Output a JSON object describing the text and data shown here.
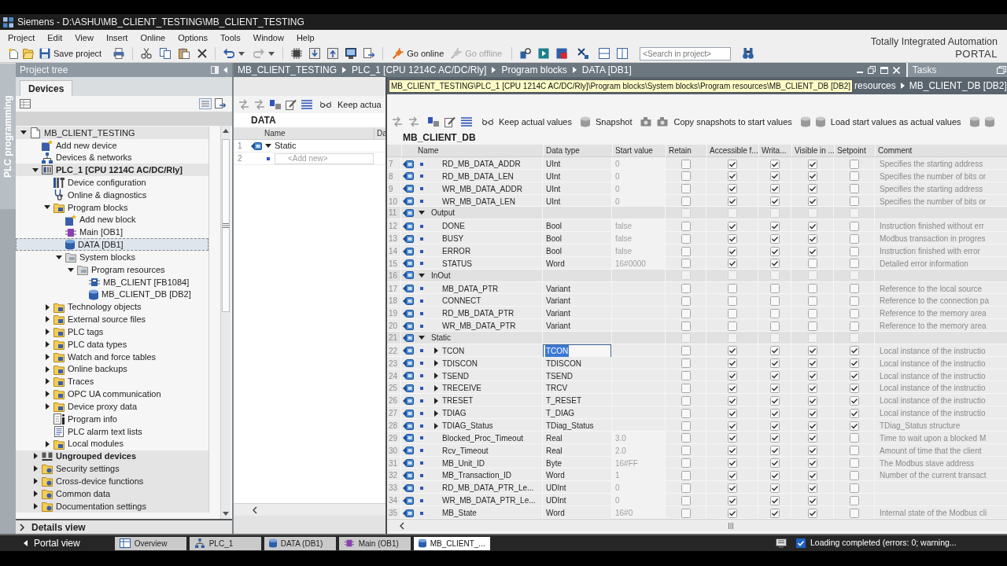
{
  "title_bar": {
    "title": "Siemens - D:\\ASHU\\MB_CLIENT_TESTING\\MB_CLIENT_TESTING"
  },
  "menu": [
    "Project",
    "Edit",
    "View",
    "Insert",
    "Online",
    "Options",
    "Tools",
    "Window",
    "Help"
  ],
  "toolbar": {
    "buttons": [
      {
        "kind": "save",
        "label": "Save project",
        "disabled": false
      },
      {
        "kind": "undo",
        "disabled": false
      },
      {
        "kind": "redo",
        "disabled": true
      },
      {
        "kind": "online",
        "label": "Go online",
        "disabled": false
      },
      {
        "kind": "offline",
        "label": "Go offline",
        "disabled": true
      }
    ],
    "search": {
      "placeholder": "<Search in project>"
    }
  },
  "branding": {
    "line_1": "Totally Integrated Automation",
    "line_2": "PORTAL"
  },
  "side_tab": {
    "label": "PLC programming"
  },
  "project_tree": {
    "title": "Project tree",
    "tabs": [
      {
        "label": "Devices",
        "selected": true
      }
    ],
    "items": [
      {
        "label": "MB_CLIENT_TESTING",
        "kind": "project",
        "expanded": true,
        "selected": false,
        "children": [
          {
            "label": "Add new device",
            "kind": "add",
            "selected": false
          },
          {
            "label": "Devices & networks",
            "kind": "network",
            "selected": false
          },
          {
            "label": "PLC_1 [CPU 1214C AC/DC/Rly]",
            "kind": "plc",
            "expanded": true,
            "selected": false,
            "children": [
              {
                "label": "Device configuration",
                "kind": "config",
                "selected": false
              },
              {
                "label": "Online & diagnostics",
                "kind": "diagnostics",
                "selected": false
              },
              {
                "label": "Program blocks",
                "kind": "folder",
                "expanded": true,
                "selected": false,
                "children": [
                  {
                    "label": "Add new block",
                    "kind": "add",
                    "selected": false
                  },
                  {
                    "label": "Main [OB1]",
                    "kind": "ob",
                    "selected": false
                  },
                  {
                    "label": "DATA [DB1]",
                    "kind": "db",
                    "selected": true
                  },
                  {
                    "label": "System blocks",
                    "kind": "system_folder",
                    "expanded": true,
                    "selected": false,
                    "children": [
                      {
                        "label": "Program resources",
                        "kind": "system_folder",
                        "expanded": true,
                        "selected": false,
                        "children": [
                          {
                            "label": "MB_CLIENT [FB1084]",
                            "kind": "fb",
                            "selected": false
                          },
                          {
                            "label": "MB_CLIENT_DB [DB2]",
                            "kind": "db",
                            "selected": false
                          }
                        ]
                      }
                    ]
                  }
                ]
              },
              {
                "label": "Technology objects",
                "kind": "folder",
                "expanded": false,
                "selected": false
              },
              {
                "label": "External source files",
                "kind": "folder",
                "expanded": false,
                "selected": false
              },
              {
                "label": "PLC tags",
                "kind": "folder",
                "expanded": false,
                "selected": false
              },
              {
                "label": "PLC data types",
                "kind": "folder",
                "expanded": false,
                "selected": false
              },
              {
                "label": "Watch and force tables",
                "kind": "folder",
                "expanded": false,
                "selected": false
              },
              {
                "label": "Online backups",
                "kind": "folder",
                "expanded": false,
                "selected": false
              },
              {
                "label": "Traces",
                "kind": "folder",
                "expanded": false,
                "selected": false
              },
              {
                "label": "OPC UA communication",
                "kind": "folder",
                "expanded": false,
                "selected": false
              },
              {
                "label": "Device proxy data",
                "kind": "folder",
                "expanded": false,
                "selected": false
              },
              {
                "label": "Program info",
                "kind": "info",
                "selected": false
              },
              {
                "label": "PLC alarm text lists",
                "kind": "text_list",
                "selected": false
              },
              {
                "label": "Local modules",
                "kind": "folder",
                "expanded": false,
                "selected": false
              }
            ]
          },
          {
            "label": "Ungrouped devices",
            "kind": "device_group",
            "expanded": false,
            "selected": false
          },
          {
            "label": "Security settings",
            "kind": "group",
            "expanded": false,
            "selected": false
          },
          {
            "label": "Cross-device functions",
            "kind": "group",
            "expanded": false,
            "selected": false
          },
          {
            "label": "Common data",
            "kind": "group",
            "expanded": false,
            "selected": false
          },
          {
            "label": "Documentation settings",
            "kind": "group",
            "expanded": false,
            "selected": false
          }
        ]
      }
    ]
  },
  "details_view": {
    "label": "Details view",
    "expanded": false
  },
  "breadcrumb": [
    "MB_CLIENT_TESTING",
    "PLC_1 [CPU 1214C AC/DC/Rly]",
    "Program blocks",
    "DATA [DB1]"
  ],
  "tasks": {
    "title": "Tasks"
  },
  "data_editor": {
    "toolbar_labels": [
      "Keep actua"
    ],
    "block_name": "DATA",
    "columns": [
      "Name",
      "Da"
    ],
    "rows": [
      {
        "num": "1",
        "kind": "section",
        "name": "Static",
        "expanded": true,
        "children": [
          {
            "num": "2",
            "kind": "add",
            "placeholder": "<Add new>"
          }
        ]
      }
    ]
  },
  "db_editor": {
    "tooltip": "MB_CLIENT_TESTING\\PLC_1 [CPU 1214C AC/DC/Rly]\\Program blocks\\System blocks\\Program resources\\MB_CLIENT_DB [DB2]",
    "breadcrumb": [
      "resources",
      "MB_CLIENT_DB [DB2]"
    ],
    "toolbar_labels": [
      "Keep actual values",
      "Snapshot",
      "Copy snapshots to start values",
      "Load start values as actual values"
    ],
    "block_name": "MB_CLIENT_DB",
    "columns": [
      "Name",
      "Data type",
      "Start value",
      "Retain",
      "Accessible f...",
      "Writa...",
      "Visible in ...",
      "Setpoint",
      "Comment"
    ],
    "rows": [
      {
        "num": "7",
        "kind": "member",
        "name": "RD_MB_DATA_ADDR",
        "data_type": "UInt",
        "start_value": "0",
        "retain": false,
        "accessible": true,
        "writable": true,
        "visible": true,
        "setpoint": false,
        "comment": "Specifies the starting address",
        "selected": false
      },
      {
        "num": "8",
        "kind": "member",
        "name": "RD_MB_DATA_LEN",
        "data_type": "UInt",
        "start_value": "0",
        "retain": false,
        "accessible": true,
        "writable": true,
        "visible": true,
        "setpoint": false,
        "comment": "Specifies the number of bits or",
        "selected": false
      },
      {
        "num": "9",
        "kind": "member",
        "name": "WR_MB_DATA_ADDR",
        "data_type": "UInt",
        "start_value": "0",
        "retain": false,
        "accessible": true,
        "writable": true,
        "visible": true,
        "setpoint": false,
        "comment": "Specifies the starting address",
        "selected": false
      },
      {
        "num": "10",
        "kind": "member",
        "name": "WR_MB_DATA_LEN",
        "data_type": "UInt",
        "start_value": "0",
        "retain": false,
        "accessible": true,
        "writable": true,
        "visible": true,
        "setpoint": false,
        "comment": "Specifies the number of bits or",
        "selected": false
      },
      {
        "num": "11",
        "kind": "section",
        "name": "Output",
        "expanded": true,
        "retain": false,
        "accessible": false,
        "writable": false,
        "visible": false,
        "setpoint": false,
        "children": [
          {
            "num": "12",
            "kind": "member",
            "name": "DONE",
            "data_type": "Bool",
            "start_value": "false",
            "retain": false,
            "accessible": true,
            "writable": true,
            "visible": true,
            "setpoint": false,
            "comment": "Instruction finished without err",
            "selected": false
          },
          {
            "num": "13",
            "kind": "member",
            "name": "BUSY",
            "data_type": "Bool",
            "start_value": "false",
            "retain": false,
            "accessible": true,
            "writable": true,
            "visible": true,
            "setpoint": false,
            "comment": "Modbus transaction in progres",
            "selected": false
          },
          {
            "num": "14",
            "kind": "member",
            "name": "ERROR",
            "data_type": "Bool",
            "start_value": "false",
            "retain": false,
            "accessible": true,
            "writable": true,
            "visible": true,
            "setpoint": false,
            "comment": "Instruction finished with error",
            "selected": false
          },
          {
            "num": "15",
            "kind": "member",
            "name": "STATUS",
            "data_type": "Word",
            "start_value": "16#0000",
            "retain": false,
            "accessible": true,
            "writable": true,
            "visible": false,
            "setpoint": false,
            "comment": "Detailed error information",
            "selected": false
          }
        ]
      },
      {
        "num": "16",
        "kind": "section",
        "name": "InOut",
        "expanded": true,
        "retain": false,
        "accessible": false,
        "writable": false,
        "visible": false,
        "setpoint": false,
        "children": [
          {
            "num": "17",
            "kind": "member",
            "name": "MB_DATA_PTR",
            "data_type": "Variant",
            "retain": false,
            "accessible": false,
            "writable": false,
            "visible": false,
            "setpoint": false,
            "comment": "Reference to the local source",
            "selected": false
          },
          {
            "num": "18",
            "kind": "member",
            "name": "CONNECT",
            "data_type": "Variant",
            "retain": false,
            "accessible": false,
            "writable": false,
            "visible": false,
            "setpoint": false,
            "comment": "Reference to the connection pa",
            "selected": false
          },
          {
            "num": "19",
            "kind": "member",
            "name": "RD_MB_DATA_PTR",
            "data_type": "Variant",
            "retain": false,
            "accessible": false,
            "writable": false,
            "visible": false,
            "setpoint": false,
            "comment": "Reference to the memory area",
            "selected": false
          },
          {
            "num": "20",
            "kind": "member",
            "name": "WR_MB_DATA_PTR",
            "data_type": "Variant",
            "retain": false,
            "accessible": false,
            "writable": false,
            "visible": false,
            "setpoint": false,
            "comment": "Reference to the memory area",
            "selected": false
          }
        ]
      },
      {
        "num": "21",
        "kind": "section",
        "name": "Static",
        "expanded": true,
        "retain": false,
        "accessible": false,
        "writable": false,
        "visible": false,
        "setpoint": false,
        "children": [
          {
            "num": "22",
            "kind": "struct",
            "name": "TCON",
            "expanded": false,
            "data_type": "TCON",
            "retain": false,
            "accessible": true,
            "writable": true,
            "visible": true,
            "setpoint": true,
            "comment": "Local instance of the instructio",
            "selected": true
          },
          {
            "num": "23",
            "kind": "struct",
            "name": "TDISCON",
            "expanded": false,
            "data_type": "TDISCON",
            "retain": false,
            "accessible": true,
            "writable": true,
            "visible": true,
            "setpoint": true,
            "comment": "Local instance of the instructio",
            "selected": false
          },
          {
            "num": "24",
            "kind": "struct",
            "name": "TSEND",
            "expanded": false,
            "data_type": "TSEND",
            "retain": false,
            "accessible": true,
            "writable": true,
            "visible": true,
            "setpoint": true,
            "comment": "Local instance of the instructio",
            "selected": false
          },
          {
            "num": "25",
            "kind": "struct",
            "name": "TRECEIVE",
            "expanded": false,
            "data_type": "TRCV",
            "retain": false,
            "accessible": true,
            "writable": true,
            "visible": true,
            "setpoint": true,
            "comment": "Local instance of the instructio",
            "selected": false
          },
          {
            "num": "26",
            "kind": "struct",
            "name": "TRESET",
            "expanded": false,
            "data_type": "T_RESET",
            "retain": false,
            "accessible": true,
            "writable": true,
            "visible": true,
            "setpoint": true,
            "comment": "Local instance of the instructio",
            "selected": false
          },
          {
            "num": "27",
            "kind": "struct",
            "name": "TDIAG",
            "expanded": false,
            "data_type": "T_DIAG",
            "retain": false,
            "accessible": true,
            "writable": true,
            "visible": true,
            "setpoint": true,
            "comment": "Local instance of the instructio",
            "selected": false
          },
          {
            "num": "28",
            "kind": "struct",
            "name": "TDIAG_Status",
            "expanded": false,
            "data_type": "TDiag_Status",
            "retain": false,
            "accessible": true,
            "writable": true,
            "visible": true,
            "setpoint": true,
            "comment": "TDiag_Status structure",
            "selected": false
          },
          {
            "num": "29",
            "kind": "member",
            "name": "Blocked_Proc_Timeout",
            "data_type": "Real",
            "start_value": "3.0",
            "retain": false,
            "accessible": true,
            "writable": true,
            "visible": true,
            "setpoint": false,
            "comment": "Time to wait upon a blocked M",
            "selected": false
          },
          {
            "num": "30",
            "kind": "member",
            "name": "Rcv_Timeout",
            "data_type": "Real",
            "start_value": "2.0",
            "retain": false,
            "accessible": true,
            "writable": true,
            "visible": true,
            "setpoint": false,
            "comment": "Amount of time that the client",
            "selected": false
          },
          {
            "num": "31",
            "kind": "member",
            "name": "MB_Unit_ID",
            "data_type": "Byte",
            "start_value": "16#FF",
            "retain": false,
            "accessible": true,
            "writable": true,
            "visible": true,
            "setpoint": false,
            "comment": "The Modbus slave address",
            "selected": false
          },
          {
            "num": "32",
            "kind": "member",
            "name": "MB_Transaction_ID",
            "data_type": "Word",
            "start_value": "1",
            "retain": false,
            "accessible": true,
            "writable": true,
            "visible": true,
            "setpoint": false,
            "comment": "Number of the current transact",
            "selected": false
          },
          {
            "num": "33",
            "kind": "member",
            "name": "RD_MB_DATA_PTR_Le...",
            "data_type": "UDInt",
            "start_value": "0",
            "retain": false,
            "accessible": true,
            "writable": true,
            "visible": true,
            "setpoint": false,
            "selected": false
          },
          {
            "num": "34",
            "kind": "member",
            "name": "WR_MB_DATA_PTR_Le...",
            "data_type": "UDInt",
            "start_value": "0",
            "retain": false,
            "accessible": true,
            "writable": true,
            "visible": true,
            "setpoint": false,
            "selected": false
          },
          {
            "num": "35",
            "kind": "member",
            "name": "MB_State",
            "data_type": "Word",
            "start_value": "16#0",
            "retain": false,
            "accessible": true,
            "writable": true,
            "visible": true,
            "setpoint": false,
            "comment": "Internal state of the Modbus cli",
            "selected": false
          }
        ]
      }
    ]
  },
  "taskbar": {
    "portal_view": "Portal view",
    "tabs": [
      {
        "label": "Overview",
        "kind": "overview",
        "selected": false
      },
      {
        "label": "PLC_1",
        "kind": "plc",
        "selected": false
      },
      {
        "label": "DATA (DB1)",
        "kind": "db",
        "selected": false
      },
      {
        "label": "Main (OB1)",
        "kind": "ob",
        "selected": false
      },
      {
        "label": "MB_CLIENT_...",
        "kind": "db",
        "selected": true
      }
    ],
    "status": "Loading completed (errors: 0; warning..."
  }
}
